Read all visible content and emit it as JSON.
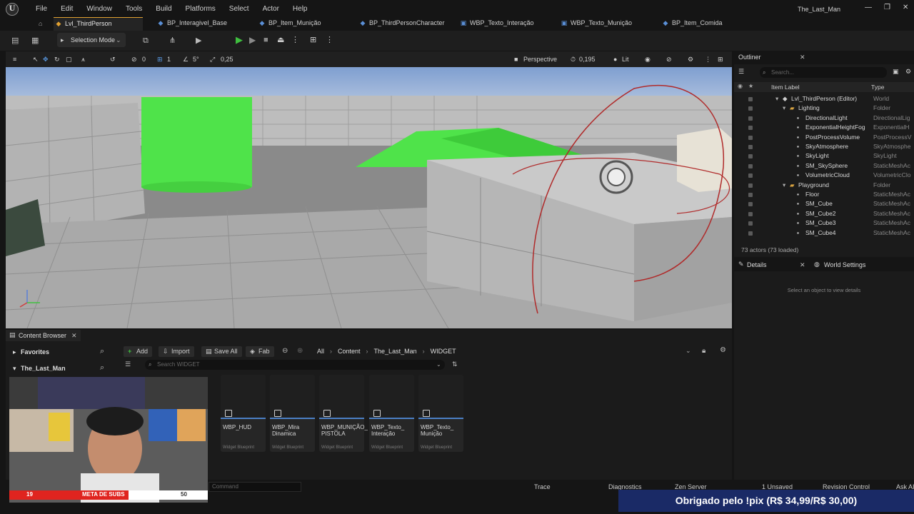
{
  "app": {
    "logo_letter": "U",
    "menu": [
      "File",
      "Edit",
      "Window",
      "Tools",
      "Build",
      "Platforms",
      "Select",
      "Actor",
      "Help"
    ],
    "project_title": "The_Last_Man",
    "window_controls": [
      "—",
      "❐",
      "✕"
    ]
  },
  "tabs": [
    {
      "label": "Lvl_ThirdPerson",
      "active": true
    },
    {
      "label": "BP_Interagivel_Base"
    },
    {
      "label": "BP_Item_Munição"
    },
    {
      "label": "BP_ThirdPersonCharacter"
    },
    {
      "label": "WBP_Texto_Interação"
    },
    {
      "label": "WBP_Texto_Munição"
    },
    {
      "label": "BP_Item_Comida"
    }
  ],
  "toolbar": {
    "selection_mode": "Selection Mode"
  },
  "viewport_toolbar": {
    "rotation_snap_value": "0",
    "grid_value": "1",
    "angle_value": "5°",
    "scale_value": "0,25",
    "perspective": "Perspective",
    "speed": "0,195",
    "lit": "Lit"
  },
  "outliner": {
    "title": "Outliner",
    "search_placeholder": "Search...",
    "col_label": "Item Label",
    "col_type": "Type",
    "rows": [
      {
        "label": "Lvl_ThirdPerson (Editor)",
        "type": "World",
        "indent": 0
      },
      {
        "label": "Lighting",
        "type": "Folder",
        "indent": 1
      },
      {
        "label": "DirectionalLight",
        "type": "DirectionalLig",
        "indent": 2
      },
      {
        "label": "ExponentialHeightFog",
        "type": "ExponentialH",
        "indent": 2
      },
      {
        "label": "PostProcessVolume",
        "type": "PostProcessV",
        "indent": 2
      },
      {
        "label": "SkyAtmosphere",
        "type": "SkyAtmosphe",
        "indent": 2
      },
      {
        "label": "SkyLight",
        "type": "SkyLight",
        "indent": 2
      },
      {
        "label": "SM_SkySphere",
        "type": "StaticMeshAc",
        "indent": 2
      },
      {
        "label": "VolumetricCloud",
        "type": "VolumetricClo",
        "indent": 2
      },
      {
        "label": "Playground",
        "type": "Folder",
        "indent": 1
      },
      {
        "label": "Floor",
        "type": "StaticMeshAc",
        "indent": 2
      },
      {
        "label": "SM_Cube",
        "type": "StaticMeshAc",
        "indent": 2
      },
      {
        "label": "SM_Cube2",
        "type": "StaticMeshAc",
        "indent": 2
      },
      {
        "label": "SM_Cube3",
        "type": "StaticMeshAc",
        "indent": 2
      },
      {
        "label": "SM_Cube4",
        "type": "StaticMeshAc",
        "indent": 2
      }
    ],
    "actor_count": "73 actors (73 loaded)"
  },
  "details": {
    "title": "Details",
    "world_settings": "World Settings",
    "empty_text": "Select an object to view details"
  },
  "content_browser": {
    "title": "Content Browser",
    "favorites": "Favorites",
    "project": "The_Last_Man",
    "add": "Add",
    "import": "Import",
    "save_all": "Save All",
    "fab": "Fab",
    "breadcrumb": [
      "All",
      "Content",
      "The_Last_Man",
      "WIDGET"
    ],
    "search_placeholder": "Search WIDGET",
    "assets": [
      {
        "name": "WBP_HUD",
        "kind": "Widget Blueprint"
      },
      {
        "name": "WBP_Mira Dinamica",
        "kind": "Widget Blueprint"
      },
      {
        "name": "WBP_MUNIÇÃO_ PISTOLA",
        "kind": "Widget Blueprint"
      },
      {
        "name": "WBP_Texto_ Interação",
        "kind": "Widget Blueprint"
      },
      {
        "name": "WBP_Texto_ Munição",
        "kind": "Widget Blueprint"
      }
    ]
  },
  "statusbar": {
    "cmd_placeholder": "Command",
    "trace": "Trace",
    "diagnostics": "Diagnostics",
    "zen": "Zen Server",
    "unsaved": "1 Unsaved",
    "revision": "Revision Control",
    "ask": "Ask AI"
  },
  "overlay": {
    "subs_current": "19",
    "subs_label": "META DE SUBS",
    "subs_goal": "50",
    "pix_message": "Obrigado pelo !pix (R$ 34,99/R$ 30,00)"
  },
  "colors": {
    "accent": "#e0a030",
    "selection_blue": "#4a7fc4",
    "green_mesh": "#4fe34a",
    "play_green": "#3fbf3f"
  }
}
